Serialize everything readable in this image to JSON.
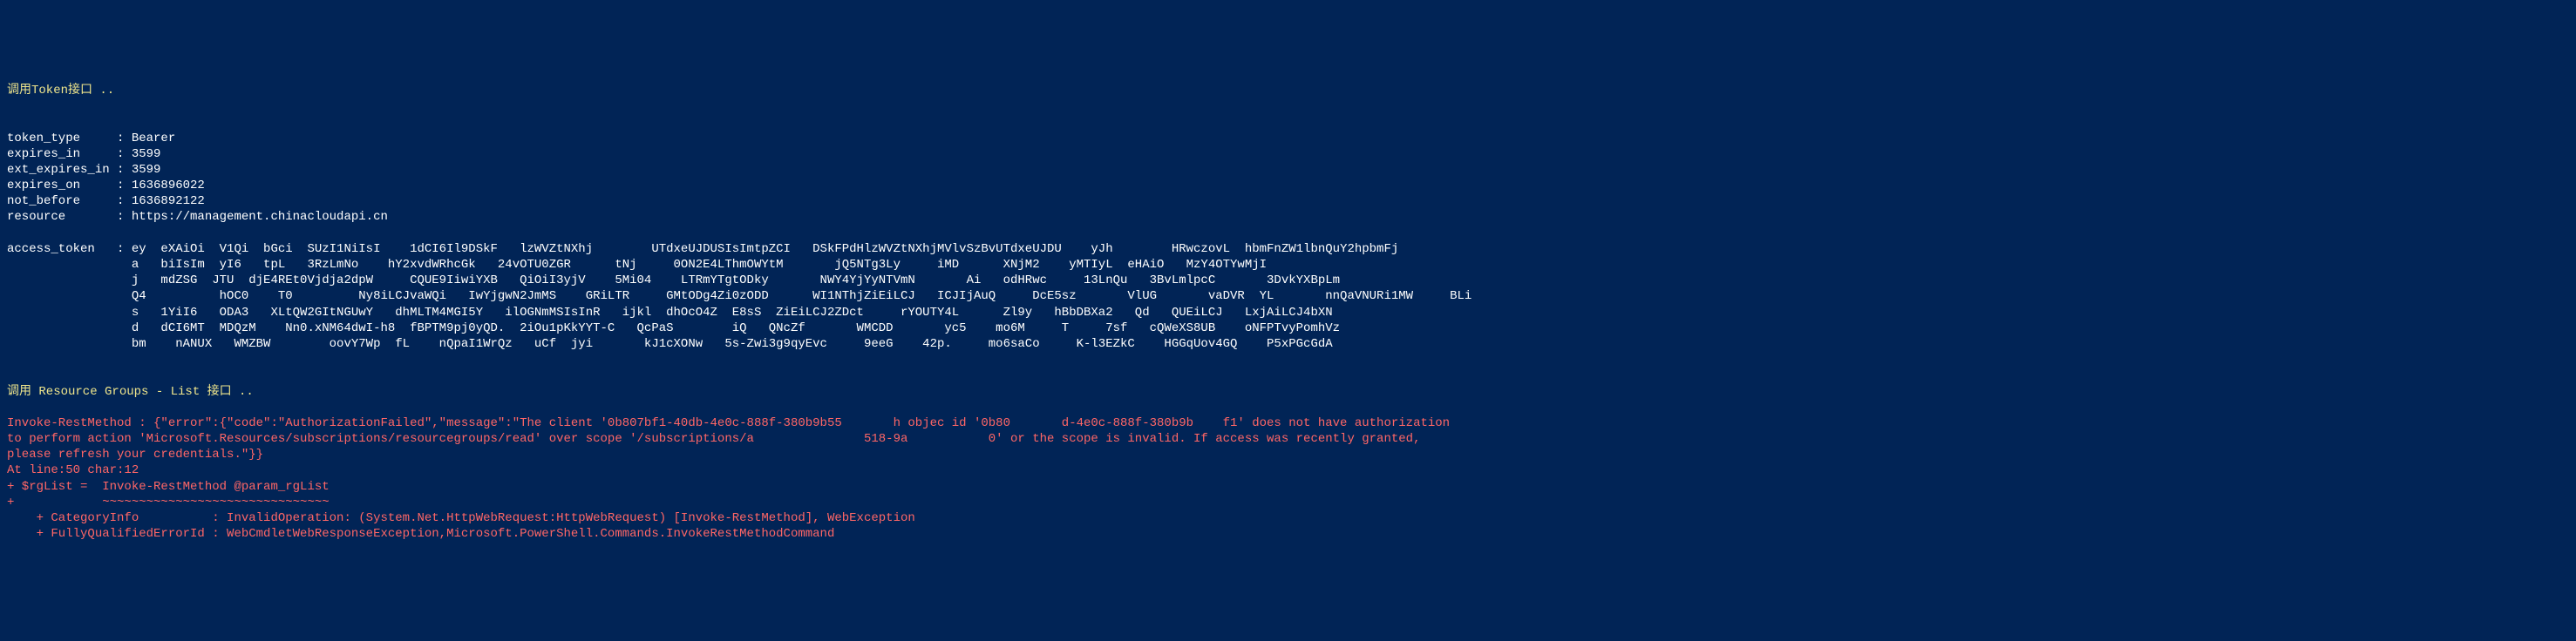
{
  "header1": "调用Token接口 ..",
  "blank": "",
  "token_fields": [
    {
      "label": "token_type     ",
      "value": ": Bearer"
    },
    {
      "label": "expires_in     ",
      "value": ": 3599"
    },
    {
      "label": "ext_expires_in ",
      "value": ": 3599"
    },
    {
      "label": "expires_on     ",
      "value": ": 1636896022"
    },
    {
      "label": "not_before     ",
      "value": ": 1636892122"
    },
    {
      "label": "resource       ",
      "value": ": https://management.chinacloudapi.cn"
    }
  ],
  "access_token_label": "access_token   ",
  "access_token_lines": [
    ": ey  eXAiOi  V1Qi  bGci  SUzI1NiIsI    1dCI6Il9DSkF   lzWVZtNXhj        UTdxeUJDUSIsImtpZCI   DSkFPdHlzWVZtNXhjMVlvSzBvUTdxeUJDU    yJh        HRwczovL  hbmFnZW1lbnQuY2hpbmFj  ",
    "  a   biIsIm  yI6   tpL   3RzLmNo    hY2xvdWRhcGk   24vOTU0ZGR      tNj     0ON2E4LThmOWYtM       jQ5NTg3Ly     iMD      XNjM2    yMTIyL  eHAiO   MzY4OTYwMjI   ",
    "  j   mdZSG  JTU  djE4REt0Vjdja2dpW     CQUE9IiwiYXB   QiOiI3yjV    5Mi04    LTRmYTgtODky       NWY4YjYyNTVmN       Ai   odHRwc     13LnQu   3BvLmlpcC       3DvkYXBpLm  ",
    "  Q4          hOC0    T0         Ny8iLCJvaWQi   IwYjgwN2JmMS    GRiLTR     GMtODg4Zi0zODD      WI1NThjZiEiLCJ   ICJIjAuQ     DcE5sz       VlUG       vaDVR  YL       nnQaVNURi1MW     BLi ",
    "  s   1YiI6   ODA3   XLtQW2GItNGUwY   dhMLTM4MGI5Y   ilOGNmMSIsInR   ijkl  dhOcO4Z  E8sS  ZiEiLCJ2ZDct     rYOUTY4L      Zl9y   hBbDBXa2   Qd   QUEiLCJ   LxjAiLCJ4bXN  ",
    "  d   dCI6MT  MDQzM    Nn0.xNM64dwI-h8  fBPTM9pj0yQD.  2iOu1pKkYYT-C   QcPaS        iQ   QNcZf       WMCDD       yc5    mo6M     T     7sf   cQWeXS8UB    oNFPTvyPomhVz",
    "  bm    nANUX   WMZBW        oovY7Wp  fL    nQpaI1WrQz   uCf  jyi       kJ1cXONw   5s-Zwi3g9qyEvc     9eeG    42p.     mo6saCo     K-l3EZkC    HGGqUov4GQ    P5xPGcGdA"
  ],
  "header2": "调用 Resource Groups - List 接口 ..",
  "error_lines": [
    "Invoke-RestMethod : {\"error\":{\"code\":\"AuthorizationFailed\",\"message\":\"The client '0b807bf1-40db-4e0c-888f-380b9b55       h objec id '0b80       d-4e0c-888f-380b9b    f1' does not have authorization",
    "to perform action 'Microsoft.Resources/subscriptions/resourcegroups/read' over scope '/subscriptions/a               518-9a           0' or the scope is invalid. If access was recently granted,",
    "please refresh your credentials.\"}}",
    "At line:50 char:12",
    "+ $rgList =  Invoke-RestMethod @param_rgList",
    "+            ~~~~~~~~~~~~~~~~~~~~~~~~~~~~~~~",
    "    + CategoryInfo          : InvalidOperation: (System.Net.HttpWebRequest:HttpWebRequest) [Invoke-RestMethod], WebException",
    "    + FullyQualifiedErrorId : WebCmdletWebResponseException,Microsoft.PowerShell.Commands.InvokeRestMethodCommand"
  ]
}
